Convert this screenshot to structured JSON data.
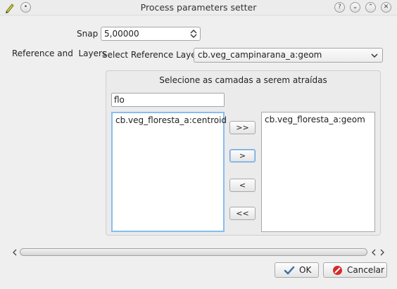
{
  "window": {
    "title": "Process parameters setter",
    "app_icon": "pencil-icon",
    "pin_icon": "pin-icon",
    "help_glyph": "?",
    "minimize_glyph": "⌄",
    "maximize_glyph": "⌃",
    "close_glyph": "✕"
  },
  "snap": {
    "label": "Snap",
    "value": "5,00000"
  },
  "reference": {
    "section_label": "Reference and  Layers",
    "select_label": "Select Reference Layer",
    "selected_layer": "cb.veg_campinarana_a:geom"
  },
  "layers_group": {
    "title": "Selecione as camadas a serem atraídas",
    "filter_value": "flo",
    "available": [
      "cb.veg_floresta_a:centroid"
    ],
    "selected": [
      "cb.veg_floresta_a:geom"
    ],
    "buttons": {
      "add_all": ">>",
      "add": ">",
      "remove": "<",
      "remove_all": "<<"
    }
  },
  "dialog_buttons": {
    "ok": "OK",
    "cancel": "Cancelar"
  },
  "colors": {
    "focus": "#86bdf0",
    "ok_check": "#3a6ea5",
    "cancel_icon": "#d22b2b"
  }
}
